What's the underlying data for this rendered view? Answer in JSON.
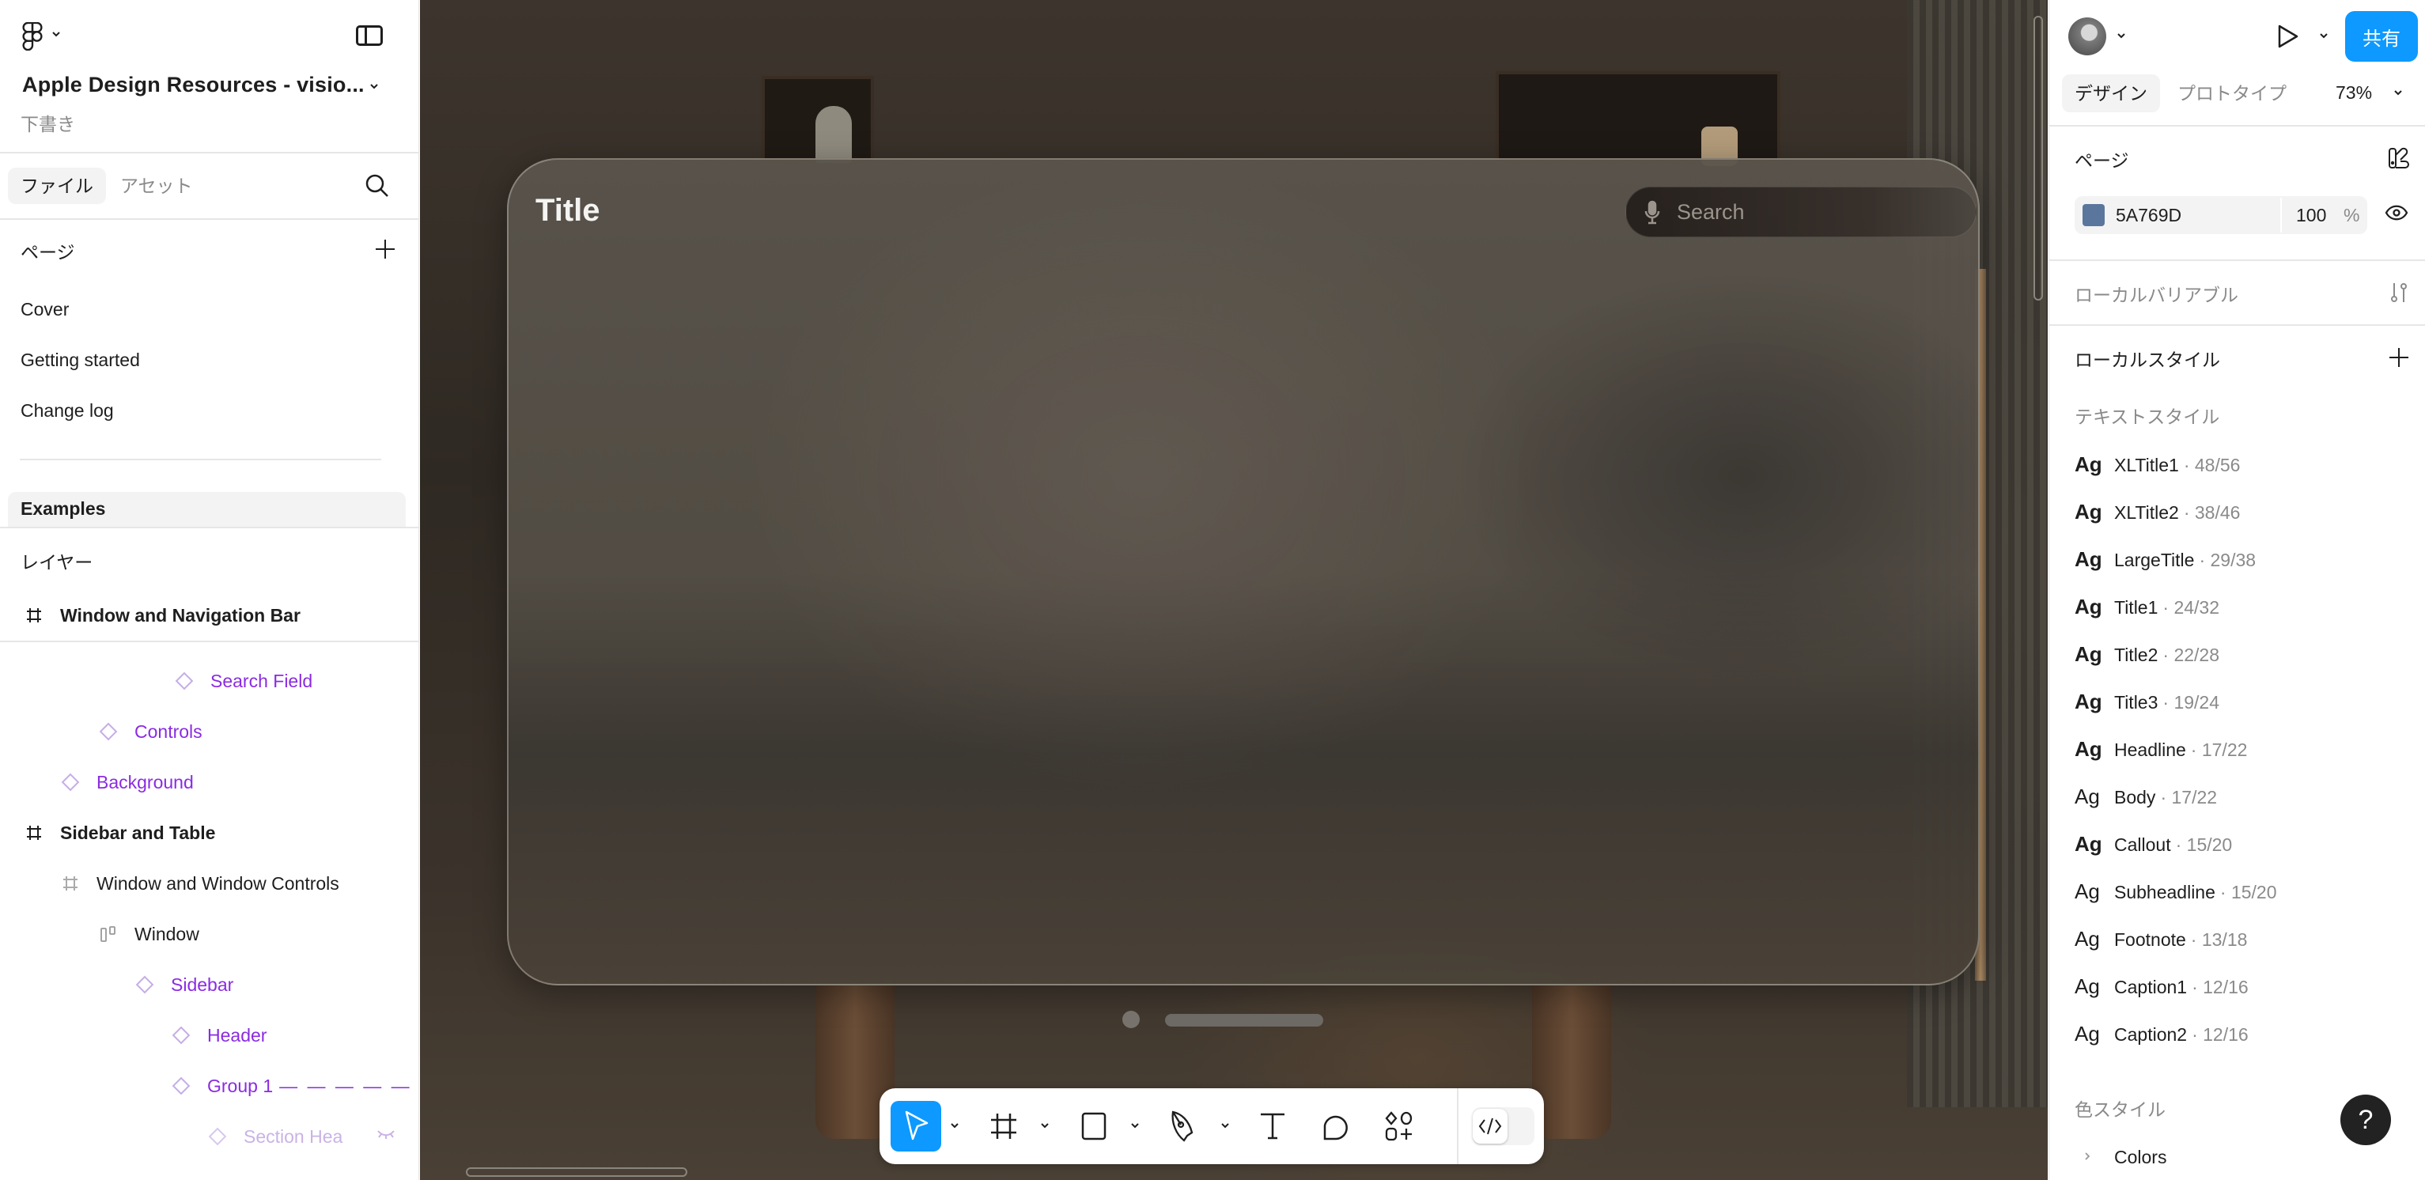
{
  "left_panel": {
    "file_title": "Apple Design Resources - visio...",
    "file_status": "下書き",
    "tabs": [
      {
        "label": "ファイル",
        "active": true
      },
      {
        "label": "アセット",
        "active": false
      }
    ],
    "pages_heading": "ページ",
    "pages": [
      {
        "label": "Cover"
      },
      {
        "label": "Getting started"
      },
      {
        "label": "Change log"
      }
    ],
    "selected_page": "Examples",
    "layers_heading": "レイヤー",
    "sticky_layer": {
      "label": "Window and Navigation Bar",
      "type": "frame"
    },
    "layers": [
      {
        "label": "Search Field",
        "type": "component",
        "depth": 4
      },
      {
        "label": "Controls",
        "type": "component",
        "depth": 2
      },
      {
        "label": "Background",
        "type": "component",
        "depth": 1
      },
      {
        "label": "Sidebar and Table",
        "type": "frame",
        "depth": 0
      },
      {
        "label": "Window and Window Controls",
        "type": "frame",
        "depth": 1
      },
      {
        "label": "Window",
        "type": "autolayout",
        "depth": 2
      },
      {
        "label": "Sidebar",
        "type": "component",
        "depth": 3
      },
      {
        "label": "Header",
        "type": "component",
        "depth": 4
      },
      {
        "label": "Group 1",
        "type": "component",
        "depth": 4,
        "suffix": "— — — — — — —"
      },
      {
        "label": "Section Hea",
        "type": "component",
        "depth": 5,
        "hidden": true
      }
    ]
  },
  "canvas": {
    "window_title": "Title",
    "search_placeholder": "Search"
  },
  "toolbar": {
    "tools": [
      {
        "name": "move",
        "icon": "cursor-icon",
        "active": true,
        "has_menu": true
      },
      {
        "name": "frame",
        "icon": "frame-icon",
        "active": false,
        "has_menu": true
      },
      {
        "name": "rectangle",
        "icon": "rectangle-icon",
        "active": false,
        "has_menu": true
      },
      {
        "name": "pen",
        "icon": "pen-icon",
        "active": false,
        "has_menu": true
      },
      {
        "name": "text",
        "icon": "text-icon",
        "active": false,
        "has_menu": false
      },
      {
        "name": "comment",
        "icon": "comment-icon",
        "active": false,
        "has_menu": false
      },
      {
        "name": "actions",
        "icon": "actions-icon",
        "active": false,
        "has_menu": false
      }
    ],
    "dev_mode_icon": "code-icon"
  },
  "right_panel": {
    "share_label": "共有",
    "tabs": [
      {
        "label": "デザイン",
        "active": true
      },
      {
        "label": "プロトタイプ",
        "active": false
      }
    ],
    "zoom": "73%",
    "page_heading": "ページ",
    "page_color": {
      "hex": "5A769D",
      "swatch": "#5A769D",
      "opacity": "100",
      "unit": "%"
    },
    "local_variables": "ローカルバリアブル",
    "local_styles": "ローカルスタイル",
    "text_styles_heading": "テキストスタイル",
    "text_styles": [
      {
        "ag": "Ag",
        "name": "XLTitle1",
        "size": "· 48/56",
        "bold": true
      },
      {
        "ag": "Ag",
        "name": "XLTitle2",
        "size": "· 38/46",
        "bold": true
      },
      {
        "ag": "Ag",
        "name": "LargeTitle",
        "size": "· 29/38",
        "bold": true
      },
      {
        "ag": "Ag",
        "name": "Title1",
        "size": "· 24/32",
        "bold": true
      },
      {
        "ag": "Ag",
        "name": "Title2",
        "size": "· 22/28",
        "bold": true
      },
      {
        "ag": "Ag",
        "name": "Title3",
        "size": "· 19/24",
        "bold": true
      },
      {
        "ag": "Ag",
        "name": "Headline",
        "size": "· 17/22",
        "bold": true
      },
      {
        "ag": "Ag",
        "name": "Body",
        "size": "· 17/22",
        "bold": false
      },
      {
        "ag": "Ag",
        "name": "Callout",
        "size": "· 15/20",
        "bold": true
      },
      {
        "ag": "Ag",
        "name": "Subheadline",
        "size": "· 15/20",
        "bold": false
      },
      {
        "ag": "Ag",
        "name": "Footnote",
        "size": "· 13/18",
        "bold": false
      },
      {
        "ag": "Ag",
        "name": "Caption1",
        "size": "· 12/16",
        "bold": false
      },
      {
        "ag": "Ag",
        "name": "Caption2",
        "size": "· 12/16",
        "bold": false
      }
    ],
    "color_styles_heading": "色スタイル",
    "color_groups": [
      {
        "label": "Colors"
      }
    ],
    "help_label": "?"
  },
  "colors": {
    "accent": "#0D99FF",
    "component": "#8A2BE2"
  }
}
